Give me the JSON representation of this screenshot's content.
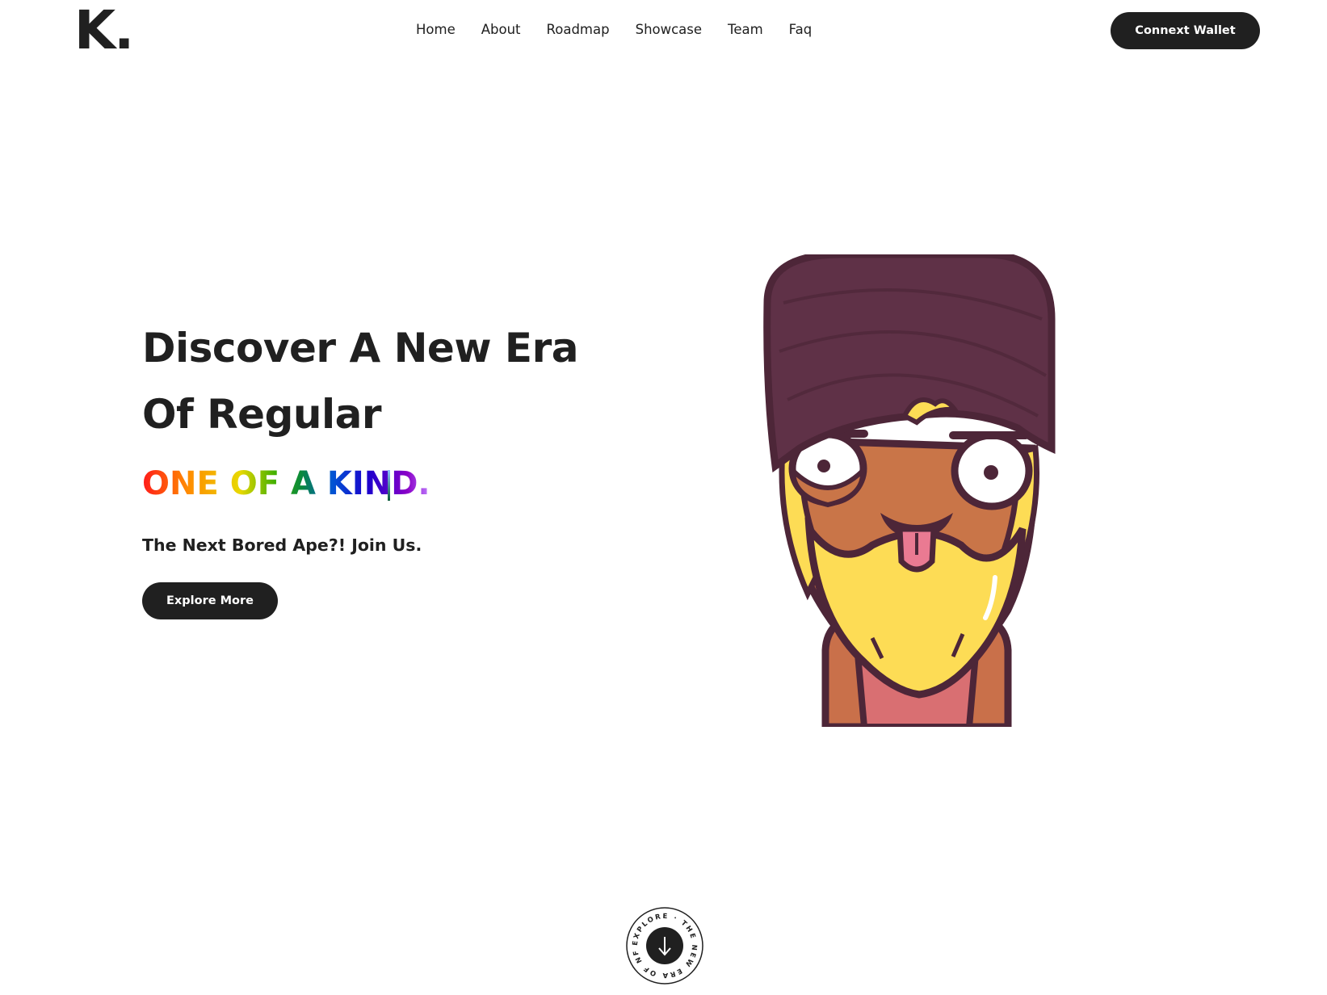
{
  "header": {
    "logo": "K.",
    "nav": [
      "Home",
      "About",
      "Roadmap",
      "Showcase",
      "Team",
      "Faq"
    ],
    "wallet_button": "Connext Wallet"
  },
  "hero": {
    "title": "Discover A New Era Of Regular",
    "typed_text": "ONE OF A KIND.",
    "subtitle": "The Next Bored Ape?! Join Us.",
    "cta": "Explore More"
  },
  "scroll_badge": {
    "ring_text": "EXPLORE · THE NEW ERA OF NFT ·",
    "icon": "arrow-down-icon"
  },
  "illustration": {
    "icon": "nft-ape-character-icon"
  },
  "colors": {
    "dark": "#202020",
    "background": "#ffffff",
    "turban": "#5f3147",
    "skin": "#c97548",
    "beard": "#fddc55",
    "shirt": "#d96f72"
  }
}
